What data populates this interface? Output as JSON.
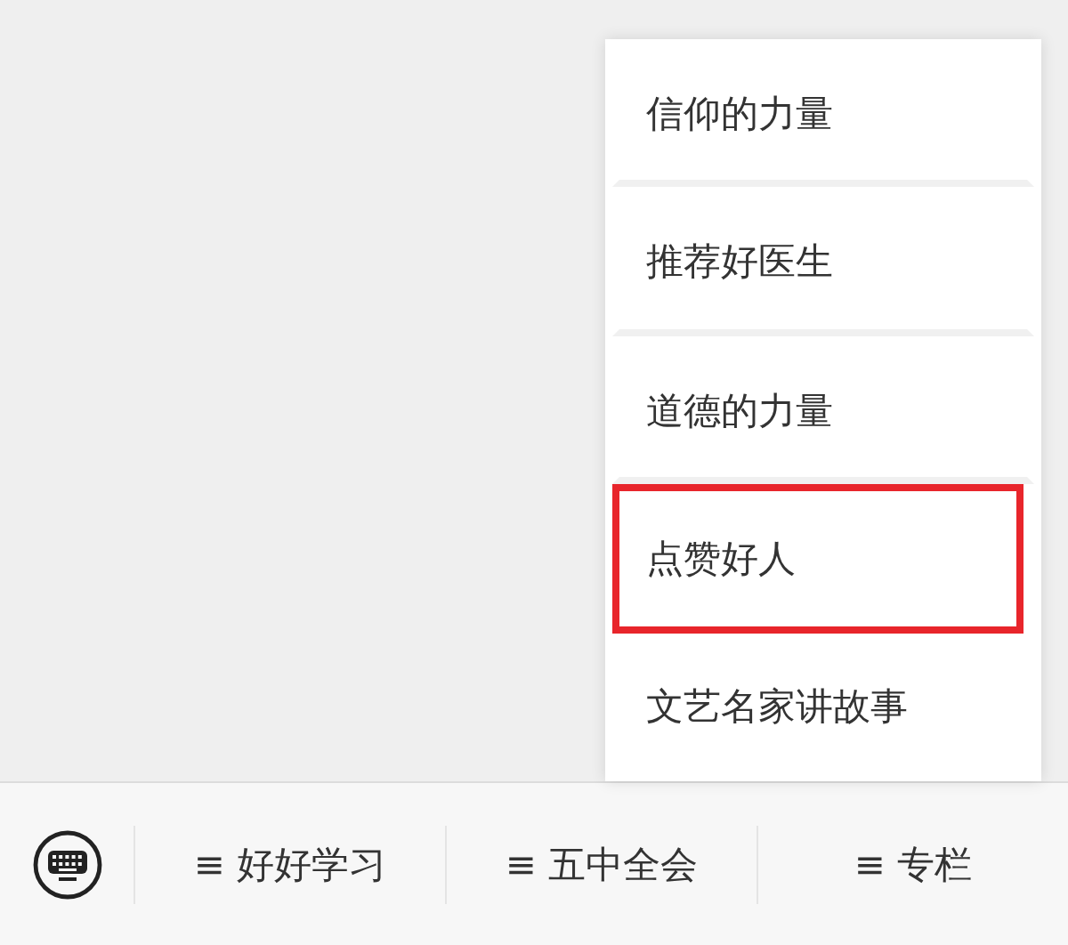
{
  "popup_menu": {
    "items": [
      {
        "label": "信仰的力量",
        "highlighted": false
      },
      {
        "label": "推荐好医生",
        "highlighted": false
      },
      {
        "label": "道德的力量",
        "highlighted": false
      },
      {
        "label": "点赞好人",
        "highlighted": true
      },
      {
        "label": "文艺名家讲故事",
        "highlighted": false
      }
    ]
  },
  "bottom_bar": {
    "menus": [
      {
        "label": "≡ 好好学习"
      },
      {
        "label": "≡ 五中全会"
      },
      {
        "label": "≡ 专栏"
      }
    ]
  }
}
